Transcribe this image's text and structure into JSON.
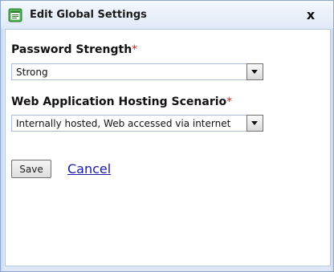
{
  "dialog": {
    "title": "Edit Global Settings",
    "icon": "document-list-icon",
    "close_label": "x"
  },
  "fields": [
    {
      "label": "Password Strength",
      "required_mark": "*",
      "value": "Strong"
    },
    {
      "label": "Web Application Hosting Scenario",
      "required_mark": "*",
      "value": "Internally hosted, Web accessed via internet"
    }
  ],
  "actions": {
    "save_label": "Save",
    "cancel_label": "Cancel"
  },
  "colors": {
    "required": "#d0281e",
    "link": "#1a1aa6",
    "frame": "#dde7f5"
  }
}
